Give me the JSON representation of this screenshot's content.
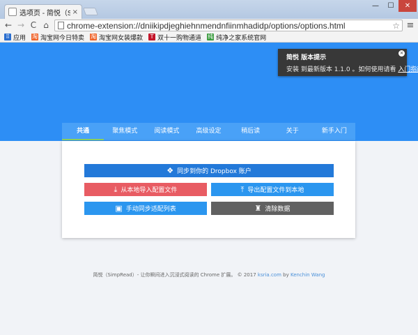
{
  "browser": {
    "tab_title": "选项页 - 简悦（SimpRead）",
    "tab_close": "×",
    "window_controls": {
      "minimize": "—",
      "maximize": "☐",
      "close": "✕"
    },
    "nav_icons": {
      "back": "←",
      "forward": "→",
      "reload": "C",
      "home": "⌂"
    },
    "url": "chrome-extension://dniikipdjeghiehnmendnfiinmhadidp/options/options.html",
    "star_icon": "☆",
    "menu_icon": "≡",
    "bookmarks": [
      {
        "label": "应用",
        "icon": "apps-icon",
        "color": "#2a6ecf",
        "glyph": "⠿"
      },
      {
        "label": "淘宝网今日特卖",
        "icon": "taobao-icon",
        "color": "#f0652c",
        "glyph": "淘"
      },
      {
        "label": "淘宝网女装爆款",
        "icon": "taobao-icon",
        "color": "#f0652c",
        "glyph": "淘"
      },
      {
        "label": "双十一购物通道",
        "icon": "tmall-icon",
        "color": "#c3152a",
        "glyph": "T"
      },
      {
        "label": "纯净之家系统官网",
        "icon": "site-icon",
        "color": "#3a9b3f",
        "glyph": "纯"
      }
    ]
  },
  "notice": {
    "title": "简悦 版本提示",
    "body": "安装 到最新版本 1.1.0 。如何使用请看",
    "link": "入门指南",
    "close": "×"
  },
  "nav_tabs": [
    "共通",
    "聚焦模式",
    "阅读模式",
    "高级设定",
    "稍后读",
    "关于",
    "新手入门"
  ],
  "buttons": {
    "dropbox": {
      "label": "同步到你的 Dropbox 账户",
      "icon": "dropbox-icon",
      "glyph": "❖"
    },
    "import": {
      "label": "从本地导入配置文件",
      "icon": "download-icon",
      "glyph": "⤓"
    },
    "export": {
      "label": "导出配置文件到本地",
      "icon": "upload-icon",
      "glyph": "⤒"
    },
    "sync": {
      "label": "手动同步适配列表",
      "icon": "sync-list-icon",
      "glyph": "▣"
    },
    "clear": {
      "label": "清除数据",
      "icon": "clear-icon",
      "glyph": "♜"
    }
  },
  "footer": {
    "text": "简悦（SimpRead）- 让你瞬间进入沉浸式阅读的 Chrome 扩展。 © 2017",
    "site": "ksria.com",
    "by": "by",
    "author": "Kenchin Wang"
  },
  "colors": {
    "hero": "#2d8ef5",
    "nav": "#49a1f7",
    "active_indicator": "#8dd35f",
    "dropbox": "#2379d9",
    "import": "#e85c63",
    "primary": "#2b96ef",
    "clear": "#616161"
  }
}
